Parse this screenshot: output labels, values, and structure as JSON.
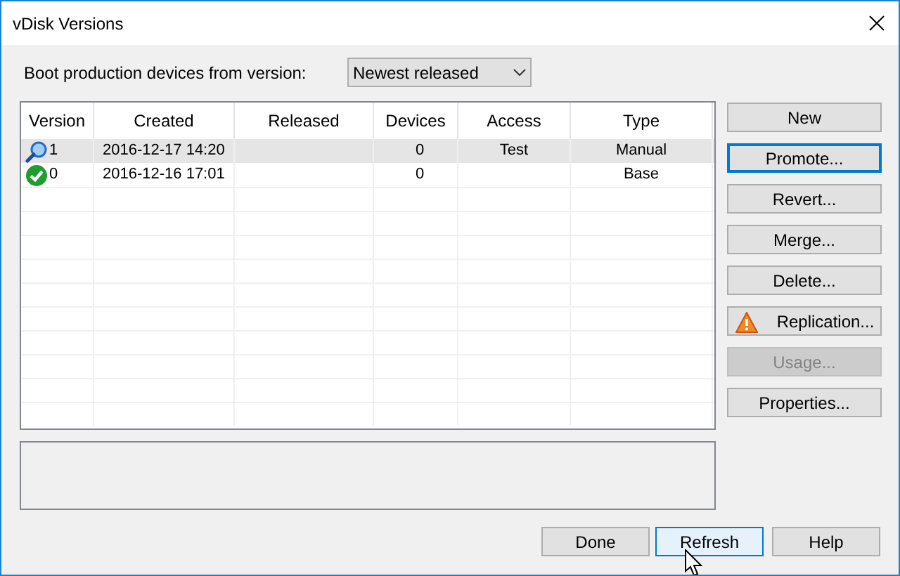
{
  "window": {
    "title": "vDisk Versions"
  },
  "boot": {
    "label": "Boot production devices from version:",
    "value": "Newest released"
  },
  "table": {
    "columns": [
      "Version",
      "Created",
      "Released",
      "Devices",
      "Access",
      "Type"
    ],
    "rows": [
      {
        "kind": "test",
        "selected": true,
        "cells": [
          "1",
          "2016-12-17 14:20",
          "",
          "0",
          "Test",
          "Manual"
        ]
      },
      {
        "kind": "base",
        "selected": false,
        "cells": [
          "0",
          "2016-12-16 17:01",
          "",
          "0",
          "",
          "Base"
        ]
      }
    ]
  },
  "side_buttons": [
    {
      "label": "New",
      "focused": false,
      "disabled": false,
      "kind": "plain"
    },
    {
      "label": "Promote...",
      "focused": true,
      "disabled": false,
      "kind": "plain"
    },
    {
      "label": "Revert...",
      "focused": false,
      "disabled": false,
      "kind": "plain"
    },
    {
      "label": "Merge...",
      "focused": false,
      "disabled": false,
      "kind": "plain"
    },
    {
      "label": "Delete...",
      "focused": false,
      "disabled": false,
      "kind": "plain"
    },
    {
      "label": "Replication...",
      "focused": false,
      "disabled": false,
      "kind": "warning"
    },
    {
      "label": "Usage...",
      "focused": false,
      "disabled": true,
      "kind": "plain"
    },
    {
      "label": "Properties...",
      "focused": false,
      "disabled": false,
      "kind": "plain"
    }
  ],
  "bottom_buttons": [
    {
      "label": "Done",
      "hovered": false
    },
    {
      "label": "Refresh",
      "hovered": true
    },
    {
      "label": "Help",
      "hovered": false
    }
  ]
}
